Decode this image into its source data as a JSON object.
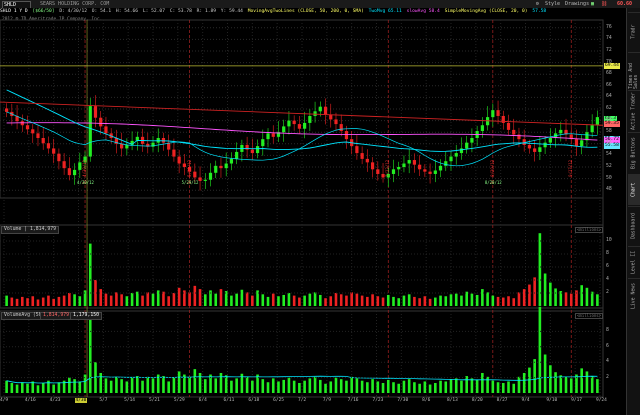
{
  "header": {
    "symbol": "SHLD",
    "company": "SEARS HOLDING CORP. COM",
    "tools": [
      "Style",
      "Drawings"
    ],
    "last_price_label": "60.60"
  },
  "studybar": [
    {
      "text": "SHLD 1 Y D",
      "color": "#ffffff"
    },
    {
      "text": "[$66/50]",
      "color": "#88ff88"
    },
    {
      "text": "D: 4/30/12",
      "color": "#cccccc"
    },
    {
      "text": "O: 54.1",
      "color": "#cccccc"
    },
    {
      "text": "H: 54.66",
      "color": "#cccccc"
    },
    {
      "text": "L: 52.07",
      "color": "#cccccc"
    },
    {
      "text": "C: 53.78",
      "color": "#cccccc"
    },
    {
      "text": "R: 1.89",
      "color": "#cccccc"
    },
    {
      "text": "Y: 59.44",
      "color": "#cccccc"
    },
    {
      "text": "MovingAvgTwoLines (CLOSE, 50, 200, 0, SMA)",
      "color": "#ffff66"
    },
    {
      "text": "TwoMvg 65.11",
      "color": "#00e5ff"
    },
    {
      "text": "slowAvg 58.4",
      "color": "#ff55ff"
    },
    {
      "text": "SimpleMovingAvg (CLOSE, 20, 0)",
      "color": "#ffff66"
    },
    {
      "text": "57.58",
      "color": "#00e5ff"
    }
  ],
  "copyright": "2012 ® TD Ameritrade IP Company, Inc.",
  "right_tabs": [
    "Tradr",
    "Times And Sales",
    "Active Trader",
    "Big Buttons",
    "Chart",
    "Dashboard",
    "Level II",
    "Live News"
  ],
  "active_tab": "Chart",
  "price_axis": [
    "76",
    "74",
    "72",
    "70",
    "68",
    "66",
    "64",
    "62",
    "60",
    "58",
    "56",
    "54",
    "52",
    "50",
    "48"
  ],
  "price_tags": [
    {
      "text": "69.44",
      "bg": "#e8e84a",
      "value": 69.44
    },
    {
      "text": "60.3",
      "bg": "#44ff66",
      "value": 60.3
    },
    {
      "text": "59.35",
      "bg": "#ff6666",
      "value": 59.35
    },
    {
      "text": "56.78",
      "bg": "#66e5ff",
      "value": 56.78
    },
    {
      "text": "56.72",
      "bg": "#ff66ff",
      "value": 56.72
    },
    {
      "text": "55.58",
      "bg": "#66e5ff",
      "value": 55.58
    }
  ],
  "volume_panel": {
    "title": "Volume | 1,814,979",
    "mm_label": "<millions>",
    "axis": [
      "10",
      "8",
      "6",
      "4",
      "2"
    ]
  },
  "volavg_panel": {
    "title_a": "VolumeAvg (50)",
    "title_b": "1,814,979",
    "title_c": "1,179,150",
    "mm_label": "<millions>",
    "axis": [
      "8",
      "6",
      "4",
      "2"
    ]
  },
  "date_axis": [
    "4/9",
    "4/16",
    "4/23",
    "4/30",
    "5/7",
    "5/14",
    "5/21",
    "5/29",
    "6/4",
    "6/11",
    "6/18",
    "6/25",
    "7/2",
    "7/9",
    "7/16",
    "7/23",
    "7/30",
    "8/6",
    "8/13",
    "8/20",
    "8/27",
    "9/4",
    "9/10",
    "9/17",
    "9/24"
  ],
  "highlight_date": "4/30",
  "event_labels": [
    "D: 4/30/12",
    "4/30/12",
    "D: 5/29/12",
    "5/29/12",
    "7/23/12",
    "D: 8/20/12",
    "8/20/12",
    "9/17/12"
  ],
  "chart_data": {
    "type": "candlestick",
    "symbol": "SHLD",
    "period": "1 Y D",
    "ylim": [
      47,
      77
    ],
    "x_dates": [
      "4/9",
      "4/10",
      "4/11",
      "4/12",
      "4/13",
      "4/16",
      "4/17",
      "4/18",
      "4/19",
      "4/20",
      "4/23",
      "4/24",
      "4/25",
      "4/26",
      "4/27",
      "4/30",
      "5/1",
      "5/2",
      "5/3",
      "5/4",
      "5/7",
      "5/8",
      "5/9",
      "5/10",
      "5/11",
      "5/14",
      "5/15",
      "5/16",
      "5/17",
      "5/18",
      "5/21",
      "5/22",
      "5/23",
      "5/24",
      "5/25",
      "5/29",
      "5/30",
      "5/31",
      "6/1",
      "6/4",
      "6/5",
      "6/6",
      "6/7",
      "6/8",
      "6/11",
      "6/12",
      "6/13",
      "6/14",
      "6/15",
      "6/18",
      "6/19",
      "6/20",
      "6/21",
      "6/22",
      "6/25",
      "6/26",
      "6/27",
      "6/28",
      "6/29",
      "7/2",
      "7/3",
      "7/5",
      "7/6",
      "7/9",
      "7/10",
      "7/11",
      "7/12",
      "7/13",
      "7/16",
      "7/17",
      "7/18",
      "7/19",
      "7/20",
      "7/23",
      "7/24",
      "7/25",
      "7/26",
      "7/27",
      "7/30",
      "7/31",
      "8/1",
      "8/2",
      "8/3",
      "8/6",
      "8/7",
      "8/8",
      "8/9",
      "8/10",
      "8/13",
      "8/14",
      "8/15",
      "8/16",
      "8/17",
      "8/20",
      "8/21",
      "8/22",
      "8/23",
      "8/24",
      "8/27",
      "8/28",
      "8/29",
      "8/30",
      "8/31",
      "9/4",
      "9/5",
      "9/6",
      "9/7",
      "9/10",
      "9/11",
      "9/12",
      "9/13",
      "9/14",
      "9/17",
      "9/18"
    ],
    "close": [
      61.5,
      60.8,
      59.9,
      59.2,
      58.5,
      57.8,
      57.0,
      56.1,
      55.2,
      54.3,
      53.0,
      51.8,
      50.6,
      51.5,
      52.8,
      53.8,
      62.5,
      60.5,
      59.0,
      57.8,
      57.0,
      56.0,
      55.2,
      55.8,
      56.5,
      57.2,
      56.0,
      55.5,
      56.2,
      57.0,
      56.2,
      55.0,
      53.8,
      52.6,
      52.0,
      51.2,
      50.2,
      49.6,
      49.8,
      51.0,
      52.2,
      51.8,
      52.6,
      53.4,
      54.6,
      55.8,
      55.0,
      54.4,
      55.6,
      56.8,
      57.8,
      57.2,
      58.0,
      59.0,
      60.0,
      59.4,
      58.6,
      59.6,
      60.8,
      61.6,
      62.4,
      61.0,
      60.2,
      59.4,
      58.2,
      56.8,
      55.6,
      54.4,
      53.4,
      52.8,
      51.6,
      50.8,
      50.2,
      50.8,
      51.6,
      52.0,
      52.6,
      53.2,
      52.4,
      51.6,
      51.2,
      50.8,
      51.4,
      52.2,
      53.0,
      53.8,
      54.4,
      55.2,
      56.2,
      57.0,
      58.2,
      59.2,
      60.6,
      61.8,
      60.8,
      59.6,
      58.4,
      57.6,
      56.8,
      55.8,
      55.2,
      54.6,
      55.4,
      56.2,
      57.0,
      57.8,
      58.4,
      57.6,
      56.8,
      55.6,
      56.6,
      58.0,
      59.2,
      60.6
    ],
    "series": [
      {
        "name": "SMA 50",
        "color": "#00e5ff"
      },
      {
        "name": "SMA 200",
        "color": "#ff55ff"
      },
      {
        "name": "SMA 20",
        "color": "#00e5ff"
      }
    ],
    "trendline_color": "#cc2222",
    "volume_millions": [
      1.6,
      1.3,
      1.1,
      1.4,
      1.2,
      1.5,
      1.0,
      1.3,
      1.6,
      1.1,
      1.4,
      1.6,
      2.0,
      1.8,
      1.5,
      2.4,
      9.6,
      4.0,
      2.6,
      1.9,
      1.6,
      2.1,
      1.8,
      1.5,
      2.0,
      2.2,
      1.6,
      2.1,
      1.9,
      2.4,
      2.2,
      1.5,
      2.0,
      2.8,
      2.4,
      2.1,
      3.1,
      2.6,
      1.8,
      2.4,
      1.9,
      2.6,
      2.3,
      1.6,
      1.9,
      2.5,
      2.1,
      1.6,
      2.4,
      1.8,
      1.4,
      1.9,
      1.5,
      1.7,
      2.0,
      1.6,
      1.3,
      1.6,
      1.9,
      2.1,
      1.7,
      1.2,
      1.5,
      2.0,
      1.8,
      1.6,
      2.1,
      1.9,
      1.6,
      1.4,
      1.8,
      1.5,
      1.3,
      1.7,
      1.4,
      1.2,
      1.6,
      1.8,
      1.4,
      1.2,
      1.5,
      1.1,
      1.3,
      1.6,
      1.5,
      1.8,
      1.9,
      1.6,
      2.2,
      1.9,
      1.7,
      2.6,
      2.1,
      1.6,
      1.4,
      1.3,
      1.5,
      1.2,
      2.1,
      2.6,
      3.3,
      4.4,
      11.2,
      5.0,
      3.6,
      2.7,
      2.3,
      2.1,
      1.9,
      2.4,
      3.2,
      2.8,
      2.2,
      1.8
    ]
  }
}
